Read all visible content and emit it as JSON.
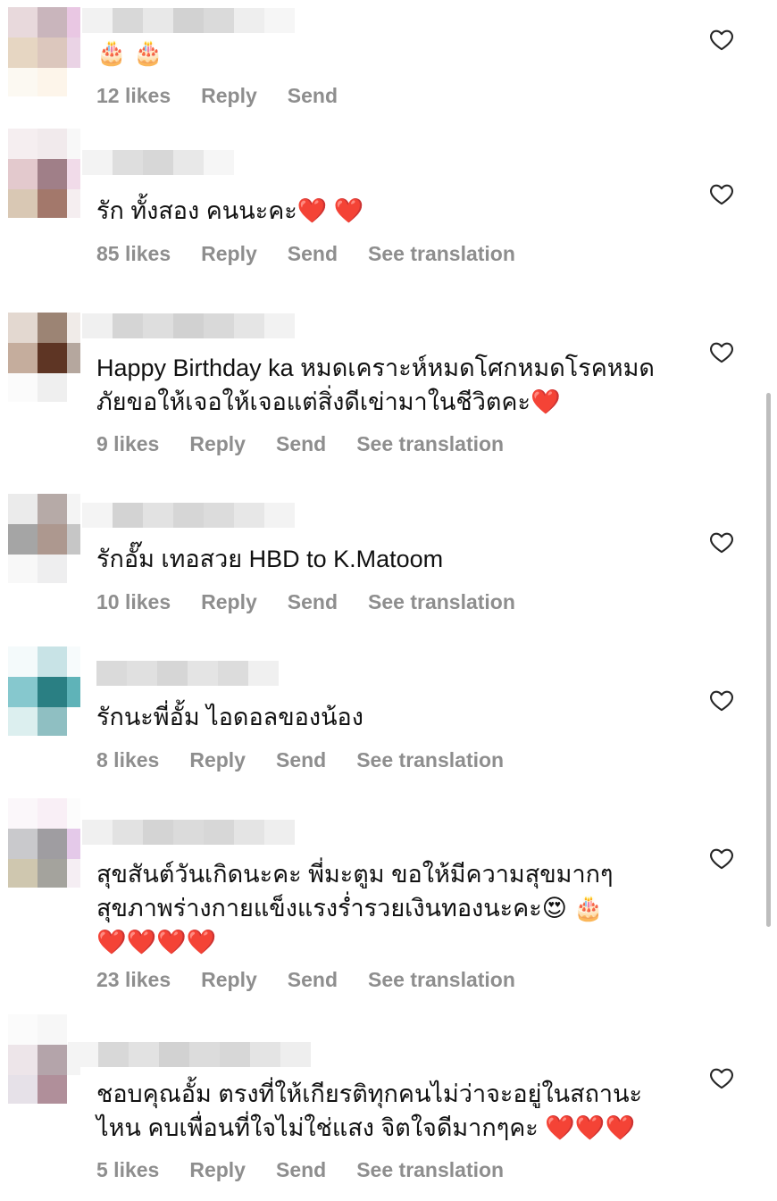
{
  "comments": [
    {
      "text": "🎂 🎂",
      "likes": "12 likes",
      "reply": "Reply",
      "send": "Send",
      "translate": ""
    },
    {
      "text": "รัก ทั้งสอง คนนะคะ❤️ ❤️",
      "likes": "85 likes",
      "reply": "Reply",
      "send": "Send",
      "translate": "See translation"
    },
    {
      "text": "Happy Birthday ka หมดเคราะห์หมดโศกหมดโรคหมด\nภัยขอให้เจอให้เจอแต่สิ่งดีเข่ามาในชีวิตคะ❤️",
      "likes": "9 likes",
      "reply": "Reply",
      "send": "Send",
      "translate": "See translation"
    },
    {
      "text": "รักอั๊ม เทอสวย HBD to K.Matoom",
      "likes": "10 likes",
      "reply": "Reply",
      "send": "Send",
      "translate": "See translation"
    },
    {
      "text": "รักนะพี่อั้ม ไอดอลของน้อง",
      "likes": "8 likes",
      "reply": "Reply",
      "send": "Send",
      "translate": "See translation"
    },
    {
      "text": "สุขสันต์วันเกิดนะคะ พี่มะตูม ขอให้มีความสุขมากๆ\nสุขภาพร่างกายแข็งแรงร่ำรวยเงินทองนะคะ😍 🎂\n❤️❤️❤️❤️",
      "likes": "23 likes",
      "reply": "Reply",
      "send": "Send",
      "translate": "See translation"
    },
    {
      "text": "ชอบคุณอั้ม ตรงที่ให้เกียรติทุกคนไม่ว่าจะอยู่ในสถานะ\nไหน คบเพื่อนที่ใจไม่ใช่แสง จิตใจดีมากๆคะ ❤️❤️❤️",
      "likes": "5 likes",
      "reply": "Reply",
      "send": "Send",
      "translate": "See translation"
    }
  ],
  "icons": {
    "like": "heart-outline-icon"
  },
  "colors": {
    "meta": "#8e8e8e",
    "text": "#111111",
    "background": "#ffffff"
  }
}
